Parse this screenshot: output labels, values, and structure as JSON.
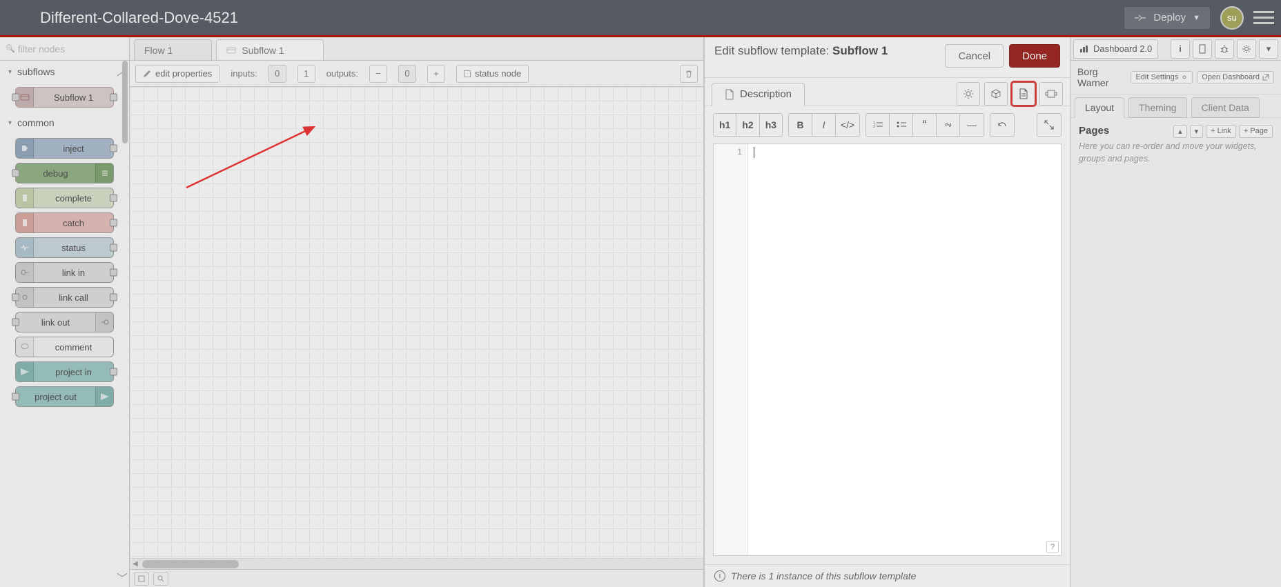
{
  "header": {
    "title": "Different-Collared-Dove-4521",
    "deploy_label": "Deploy",
    "avatar_initials": "su"
  },
  "palette": {
    "filter_placeholder": "filter nodes",
    "sections": {
      "subflows": "subflows",
      "common": "common"
    },
    "nodes": {
      "subflow1": "Subflow 1",
      "inject": "inject",
      "debug": "debug",
      "complete": "complete",
      "catch": "catch",
      "status": "status",
      "link_in": "link in",
      "link_call": "link call",
      "link_out": "link out",
      "comment": "comment",
      "project_in": "project in",
      "project_out": "project out"
    }
  },
  "workspace": {
    "tabs": {
      "flow1": "Flow 1",
      "subflow1": "Subflow 1"
    },
    "toolbar": {
      "edit_properties": "edit properties",
      "inputs_label": "inputs:",
      "inputs_val": "0",
      "inputs_one": "1",
      "outputs_label": "outputs:",
      "outputs_val": "0",
      "status_node": "status node"
    }
  },
  "tray": {
    "title_prefix": "Edit subflow template:",
    "title_name": "Subflow 1",
    "cancel": "Cancel",
    "done": "Done",
    "desc_tab": "Description",
    "md": {
      "h1": "h1",
      "h2": "h2",
      "h3": "h3"
    },
    "gutter_line": "1",
    "footer": "There is 1 instance of this subflow template"
  },
  "sidebar": {
    "dash_tab": "Dashboard 2.0",
    "site_name": "Borg Warner",
    "edit_settings": "Edit Settings",
    "open_dashboard": "Open Dashboard",
    "tabs": {
      "layout": "Layout",
      "theming": "Theming",
      "client": "Client Data"
    },
    "pages_title": "Pages",
    "link_btn": "Link",
    "page_btn": "Page",
    "hint": "Here you can re-order and move your widgets, groups and pages."
  }
}
